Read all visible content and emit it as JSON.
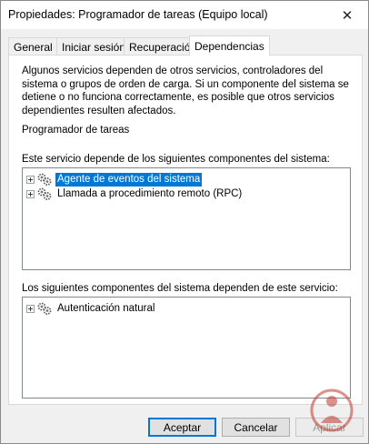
{
  "window": {
    "title": "Propiedades: Programador de tareas (Equipo local)",
    "close_glyph": "✕"
  },
  "tabs": [
    {
      "label": "General",
      "active": false
    },
    {
      "label": "Iniciar sesión",
      "active": false
    },
    {
      "label": "Recuperación",
      "active": false
    },
    {
      "label": "Dependencias",
      "active": true
    }
  ],
  "panel": {
    "description": "Algunos servicios dependen de otros servicios, controladores del sistema o grupos de orden de carga. Si un componente del sistema se detiene o no funciona correctamente, es posible que otros servicios dependientes resulten afectados.",
    "service_name": "Programador de tareas",
    "depends_on_label": "Este servicio depende de los siguientes componentes del sistema:",
    "depends_on_items": [
      {
        "label": "Agente de eventos del sistema",
        "selected": true,
        "icon": "service-gear-icon"
      },
      {
        "label": "Llamada a procedimiento remoto (RPC)",
        "selected": false,
        "icon": "service-gear-icon"
      }
    ],
    "dependents_label": "Los siguientes componentes del sistema dependen de este servicio:",
    "dependents_items": [
      {
        "label": "Autenticación natural",
        "selected": false,
        "icon": "service-gear-icon"
      }
    ]
  },
  "buttons": {
    "accept": "Aceptar",
    "cancel": "Cancelar",
    "apply": "Aplicar"
  },
  "colors": {
    "selection": "#0078d7",
    "dialog_bg": "#f0f0f0",
    "panel_bg": "#ffffff"
  }
}
